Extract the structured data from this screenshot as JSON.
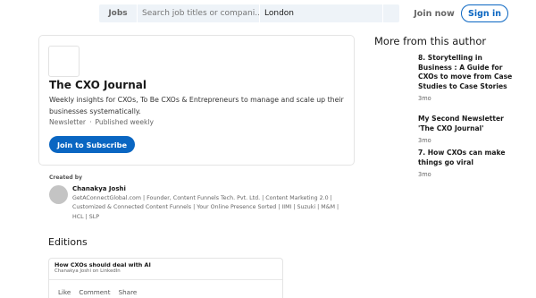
{
  "header": {
    "search_category": "Jobs",
    "search_placeholder": "Search job titles or compani...",
    "location_value": "London",
    "join_now": "Join now",
    "sign_in": "Sign in"
  },
  "newsletter": {
    "title": "The CXO Journal",
    "description": "Weekly insights for CXOs, To Be CXOs & Entrepreneurs to manage and scale up their businesses systematically.",
    "type": "Newsletter",
    "separator": "·",
    "frequency": "Published weekly",
    "subscribe_label": "Join to Subscribe"
  },
  "author": {
    "created_by_label": "Created by",
    "name": "Chanakya Joshi",
    "bio": "GetAConnectGlobal.com | Founder, Content Funnels Tech. Pvt. Ltd. | Content Marketing 2.0 | Customized & Connected Content Funnels | Your Online Presence Sorted | IIMI | Suzuki | M&M | HCL | SLP"
  },
  "editions": {
    "heading": "Editions",
    "items": [
      {
        "title": "How CXOs should deal with AI",
        "subtitle": "Chanakya Joshi on LinkedIn",
        "actions": [
          "Like",
          "Comment",
          "Share"
        ]
      }
    ]
  },
  "more_from_author": {
    "heading": "More from this author",
    "items": [
      {
        "title": "8. Storytelling in Business : A Guide for CXOs to move from Case Studies to Case Stories",
        "time": "3mo"
      },
      {
        "title": "My Second Newsletter 'The CXO Journal'",
        "time": "3mo"
      },
      {
        "title": "7. How CXOs can make things go viral",
        "time": "3mo"
      }
    ]
  },
  "colors": {
    "accent": "#0a66c2",
    "search_bg": "#eef3f8"
  }
}
